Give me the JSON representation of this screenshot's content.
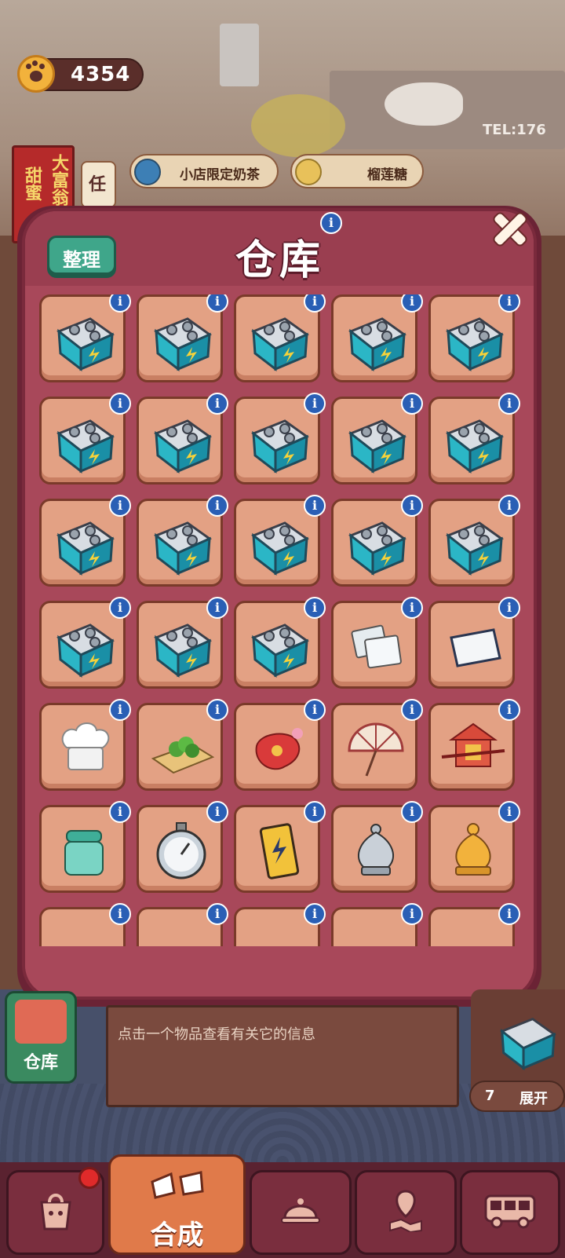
{
  "currency": {
    "icon": "paw-coin-icon",
    "value": "4354"
  },
  "banner": {
    "line1": "大富翁",
    "line2": "甜蜜"
  },
  "task_tab": {
    "label": "任"
  },
  "orders": [
    {
      "label": "小店限定奶茶",
      "icon": "milk-tea-icon"
    },
    {
      "label": "榴莲糖",
      "icon": "candy-icon"
    }
  ],
  "background": {
    "sign_text": "TEL:176"
  },
  "modal": {
    "title": "仓库",
    "info_symbol": "i",
    "sort_label": "整理",
    "close_icon": "close-x-icon",
    "items": [
      "energy-box-icon",
      "energy-box-icon",
      "energy-box-icon",
      "energy-box-icon",
      "energy-box-icon",
      "energy-box-icon",
      "energy-box-icon",
      "energy-box-icon",
      "energy-box-icon",
      "energy-box-icon",
      "energy-box-icon",
      "energy-box-icon",
      "energy-box-icon",
      "energy-box-icon",
      "energy-box-icon",
      "energy-box-icon",
      "energy-box-icon",
      "energy-box-icon",
      "glass-panels-icon",
      "paper-sheet-icon",
      "chef-hat-icon",
      "herb-cutting-board-icon",
      "red-pouch-icon",
      "paper-umbrella-icon",
      "sedan-chair-icon",
      "jar-icon",
      "stopwatch-icon",
      "energy-drink-icon",
      "silver-incense-burner-icon",
      "gold-incense-burner-icon",
      "item-icon",
      "item-icon",
      "item-icon",
      "item-icon",
      "item-icon"
    ]
  },
  "hint": {
    "text": "点击一个物品查看有关它的信息"
  },
  "side_panel": {
    "warehouse_label": "仓库",
    "expand_count": "7",
    "expand_label": "展开"
  },
  "bottom_nav": [
    {
      "name": "bag",
      "icon": "bag-icon",
      "label": ""
    },
    {
      "name": "merge",
      "icon": "merge-icon",
      "label": "合成"
    },
    {
      "name": "service",
      "icon": "cloche-icon",
      "label": ""
    },
    {
      "name": "map",
      "icon": "map-icon",
      "label": ""
    },
    {
      "name": "bus",
      "icon": "bus-icon",
      "label": ""
    }
  ],
  "colors": {
    "modal": "#a8485a",
    "slot": "#e3a184",
    "info": "#2a5fb5",
    "sort_button": "#3fa68a"
  }
}
